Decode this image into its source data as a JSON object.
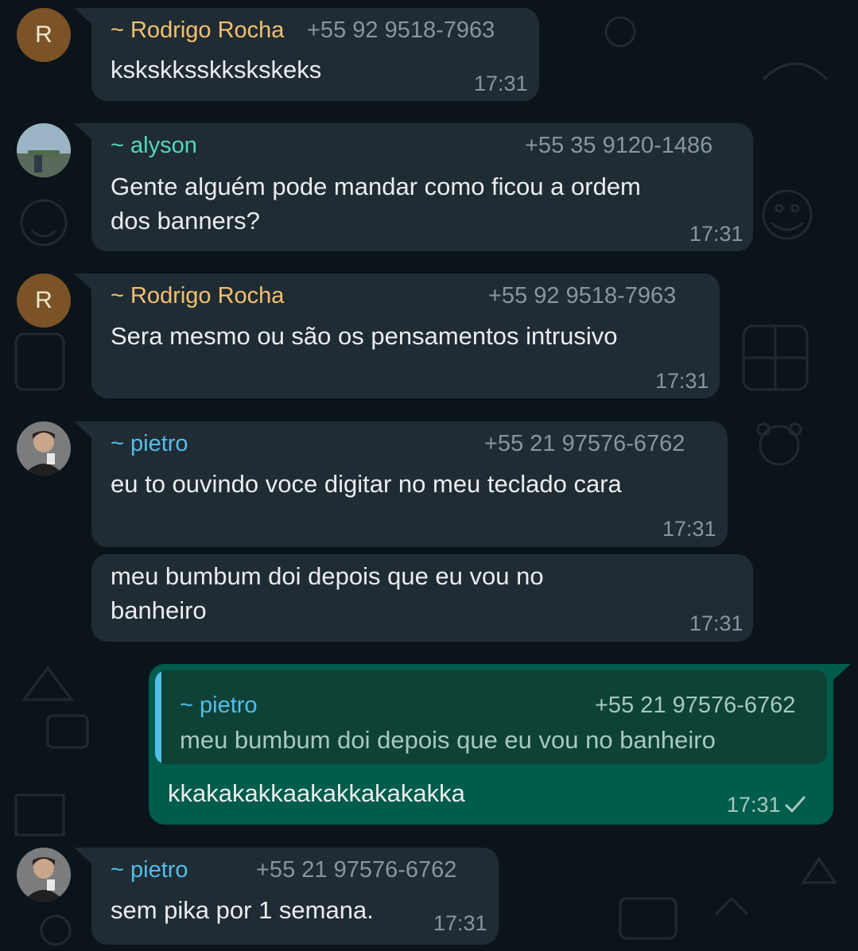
{
  "colors": {
    "rodrigo": "#f5c070",
    "alyson": "#53d6c0",
    "pietro": "#53bdeb"
  },
  "messages": [
    {
      "avatar": "R",
      "sender": "~ Rodrigo Rocha",
      "phone": "+55 92 9518-7963",
      "text": "kskskksskkskskeks",
      "time": "17:31"
    },
    {
      "sender": "~ alyson",
      "phone": "+55 35 9120-1486",
      "text": "Gente alguém pode mandar como ficou a ordem\ndos banners?",
      "time": "17:31"
    },
    {
      "avatar": "R",
      "sender": "~ Rodrigo Rocha",
      "phone": "+55 92 9518-7963",
      "text": "Sera mesmo ou são os pensamentos intrusivo",
      "time": "17:31"
    },
    {
      "sender": "~ pietro",
      "phone": "+55 21 97576-6762",
      "text": "eu to ouvindo voce digitar no meu teclado cara",
      "time": "17:31"
    },
    {
      "text": "meu bumbum doi depois que eu vou no\nbanheiro",
      "time": "17:31"
    },
    {
      "quote": {
        "sender": "~ pietro",
        "phone": "+55 21 97576-6762",
        "text": "meu bumbum doi depois que eu vou no banheiro"
      },
      "text": "kkakakakkaakakkakakakka",
      "time": "17:31",
      "status": "sent-check-icon"
    },
    {
      "sender": "~ pietro",
      "phone": "+55 21 97576-6762",
      "text": "sem pika por 1 semana.",
      "time": "17:31"
    }
  ]
}
